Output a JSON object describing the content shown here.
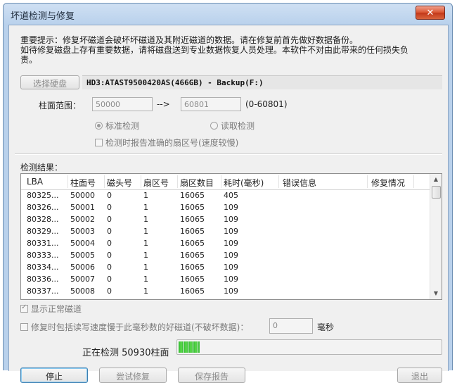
{
  "window": {
    "title": "坏道检测与修复",
    "close_glyph": "✕"
  },
  "notice": {
    "line1": "重要提示：修复坏磁道会破坏坏磁道及其附近磁道的数据。请在修复前首先做好数据备份。",
    "line2": "如待修复磁盘上存有重要数据，请将磁盘送到专业数据恢复人员处理。本软件不对由此带来的任何损失负",
    "line3": "责。"
  },
  "disk": {
    "select_button": "选择硬盘",
    "info": "HD3:ATAST9500420AS(466GB) - Backup(F:)"
  },
  "cylinder_range": {
    "label": "柱面范围：",
    "start": "50000",
    "arrow": "-->",
    "end": "60801",
    "hint": "(0-60801)"
  },
  "mode": {
    "standard_label": "标准检测",
    "read_label": "读取检测",
    "report_sector_label": "检测时报告准确的扇区号(速度较慢)"
  },
  "results": {
    "label": "检测结果：",
    "columns": [
      "LBA",
      "柱面号",
      "磁头号",
      "扇区号",
      "扇区数目",
      "耗时(毫秒)",
      "错误信息",
      "修复情况"
    ],
    "rows": [
      [
        "80325...",
        "50000",
        "0",
        "1",
        "16065",
        "405",
        "",
        ""
      ],
      [
        "80326...",
        "50001",
        "0",
        "1",
        "16065",
        "109",
        "",
        ""
      ],
      [
        "80328...",
        "50002",
        "0",
        "1",
        "16065",
        "109",
        "",
        ""
      ],
      [
        "80329...",
        "50003",
        "0",
        "1",
        "16065",
        "109",
        "",
        ""
      ],
      [
        "80331...",
        "50004",
        "0",
        "1",
        "16065",
        "109",
        "",
        ""
      ],
      [
        "80333...",
        "50005",
        "0",
        "1",
        "16065",
        "109",
        "",
        ""
      ],
      [
        "80334...",
        "50006",
        "0",
        "1",
        "16065",
        "109",
        "",
        ""
      ],
      [
        "80336...",
        "50007",
        "0",
        "1",
        "16065",
        "109",
        "",
        ""
      ],
      [
        "80337...",
        "50008",
        "0",
        "1",
        "16065",
        "109",
        "",
        ""
      ]
    ],
    "scroll_up": "▲",
    "scroll_down": "▼"
  },
  "options": {
    "show_normal_label": "显示正常磁道",
    "repair_slow_label": "修复时包括读写速度慢于此毫秒数的好磁道(不破坏数据)：",
    "ms_value": "0",
    "ms_unit": "毫秒"
  },
  "progress": {
    "status": "正在检测 50930柱面",
    "value": 0.08
  },
  "buttons": {
    "b1": "停止",
    "b2": "尝试修复",
    "b3": "保存报告",
    "b4": "退出"
  }
}
